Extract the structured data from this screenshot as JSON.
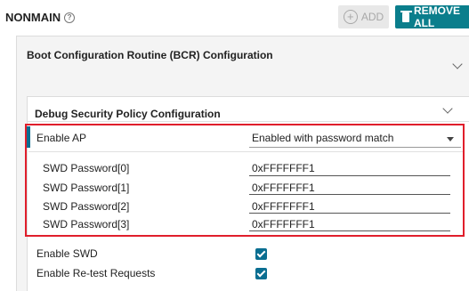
{
  "header": {
    "section_label": "NONMAIN",
    "help_glyph": "?",
    "add_label": "ADD",
    "remove_all_label": "REMOVE ALL"
  },
  "bcr_panel": {
    "title": "Boot Configuration Routine (BCR) Configuration"
  },
  "debug_panel": {
    "title": "Debug Security Policy Configuration",
    "enable_ap": {
      "label": "Enable AP",
      "value": "Enabled with password match"
    },
    "passwords": [
      {
        "label": "SWD Password[0]",
        "value": "0xFFFFFFF1"
      },
      {
        "label": "SWD Password[1]",
        "value": "0xFFFFFFF1"
      },
      {
        "label": "SWD Password[2]",
        "value": "0xFFFFFFF1"
      },
      {
        "label": "SWD Password[3]",
        "value": "0xFFFFFFF1"
      }
    ],
    "enable_swd": {
      "label": "Enable SWD",
      "checked": true
    },
    "enable_retest": {
      "label": "Enable Re-test Requests",
      "checked": true
    }
  },
  "colors": {
    "accent": "#0a6e91",
    "remove_button": "#0a7e8c",
    "highlight_border": "#e01e2b"
  }
}
